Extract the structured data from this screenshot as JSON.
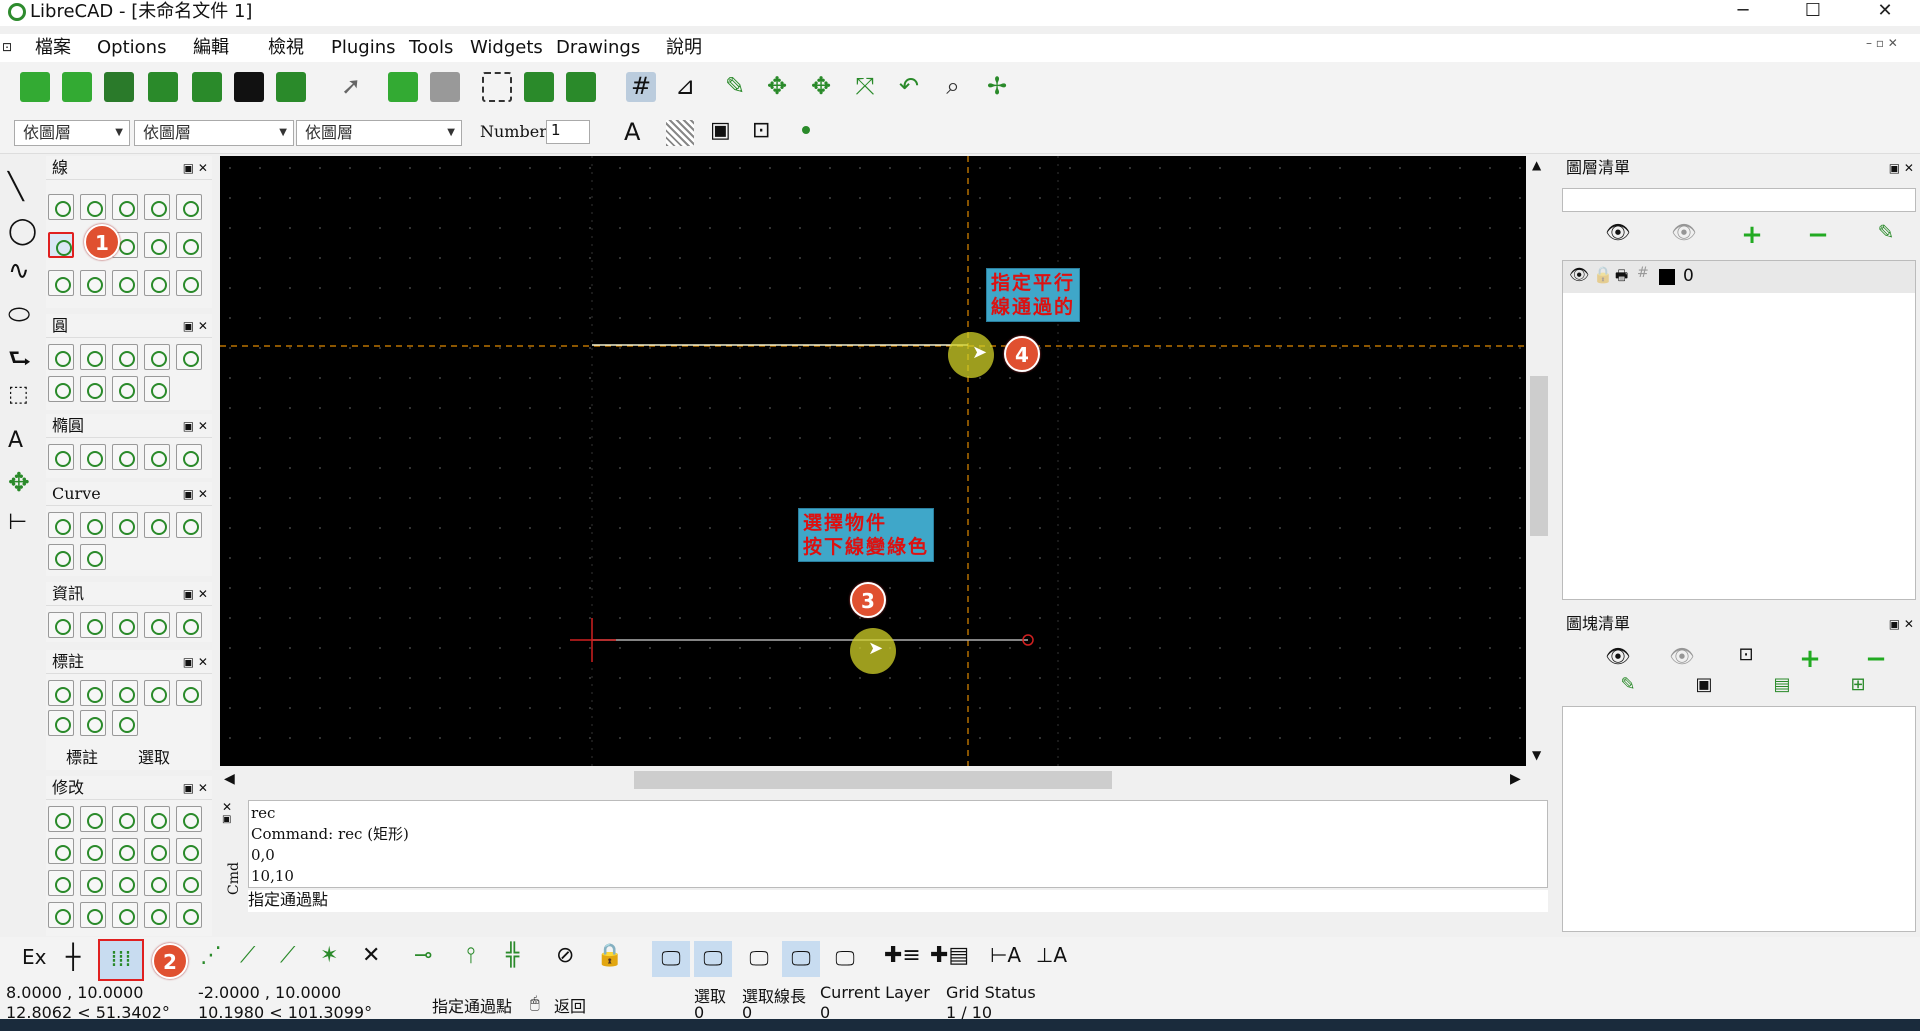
{
  "window": {
    "title": "LibreCAD - [未命名文件 1]"
  },
  "menu": [
    "檔案",
    "Options",
    "編輯",
    "檢視",
    "Plugins",
    "Tools",
    "Widgets",
    "Drawings",
    "說明"
  ],
  "toolbar2": {
    "layer_combo": "依圖層",
    "linetype_combo": "依圖層",
    "width_combo": "依圖層",
    "number_label": "Number:",
    "number_value": "1"
  },
  "panels": {
    "line": "線",
    "circle": "圓",
    "ellipse": "橢圓",
    "curve": "Curve",
    "info": "資訊",
    "dim": "標註",
    "modify": "修改"
  },
  "tabs": {
    "dim": "標註",
    "select": "選取"
  },
  "annotations": {
    "c1": "1",
    "c2": "2",
    "c3": "3",
    "c4": "4",
    "note_top": "指定平行\n線通過的",
    "note_top_l1": "指定平行",
    "note_top_l2": "線通過的",
    "note_bottom_l1": "選擇物件",
    "note_bottom_l2": "按下線變綠色"
  },
  "command": {
    "history": [
      "rec",
      "Command: rec (矩形)",
      "0,0",
      "10,10"
    ],
    "prompt": "指定通過點",
    "side_label": "Cmd"
  },
  "right": {
    "layer_list_title": "圖層清單",
    "layer_name": "0",
    "block_list_title": "圖塊清單"
  },
  "bottom": {
    "ex_label": "Ex"
  },
  "status": {
    "abs_coord": "8.0000 , 10.0000",
    "abs_polar": "12.8062 < 51.3402°",
    "rel_coord": "-2.0000 , 10.0000",
    "rel_polar": "10.1980 < 101.3099°",
    "prompt": "指定通過點",
    "back": "返回",
    "selected_label": "選取",
    "selected_value": "0",
    "sel_len_label": "選取線長",
    "sel_len_value": "0",
    "current_layer_label": "Current Layer",
    "current_layer_value": "0",
    "grid_status_label": "Grid Status",
    "grid_status_value": "1 / 10"
  },
  "colors": {
    "canvas": "#000000",
    "accent": "#2a8a2a",
    "callout": "#e05030",
    "note": "#3fa7c9",
    "snap": "#e08a00"
  }
}
